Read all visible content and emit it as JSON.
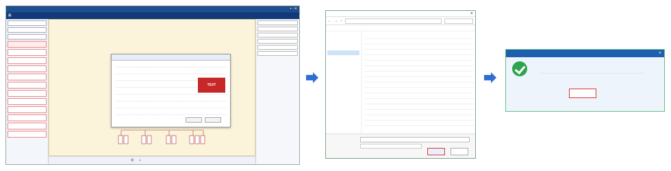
{
  "colors": {
    "accent": "#1f5fb0",
    "arrow": "#2f6fd1",
    "red": "#c62828",
    "success": "#2ea44f"
  },
  "panel1": {
    "left_items": [
      "",
      "",
      "",
      "",
      "",
      "",
      "",
      "",
      "",
      "",
      "",
      ""
    ],
    "right_labels": [
      "",
      "",
      "",
      "",
      "",
      ""
    ],
    "dialog": {
      "red_label": "TEXT",
      "buttons": [
        "",
        ""
      ]
    },
    "icons": [
      "person-icon",
      "settings-icon",
      "search-icon"
    ]
  },
  "panel2": {
    "title": "",
    "save_label": "",
    "cancel_label": "",
    "sidebar_items": [
      "",
      "",
      "",
      "",
      "",
      "",
      "",
      "",
      "",
      "",
      ""
    ],
    "file_rows": [
      "",
      "",
      "",
      "",
      "",
      "",
      "",
      "",
      "",
      "",
      "",
      "",
      "",
      "",
      "",
      "",
      ""
    ]
  },
  "panel3": {
    "title": "",
    "message": "",
    "ok_label": ""
  }
}
